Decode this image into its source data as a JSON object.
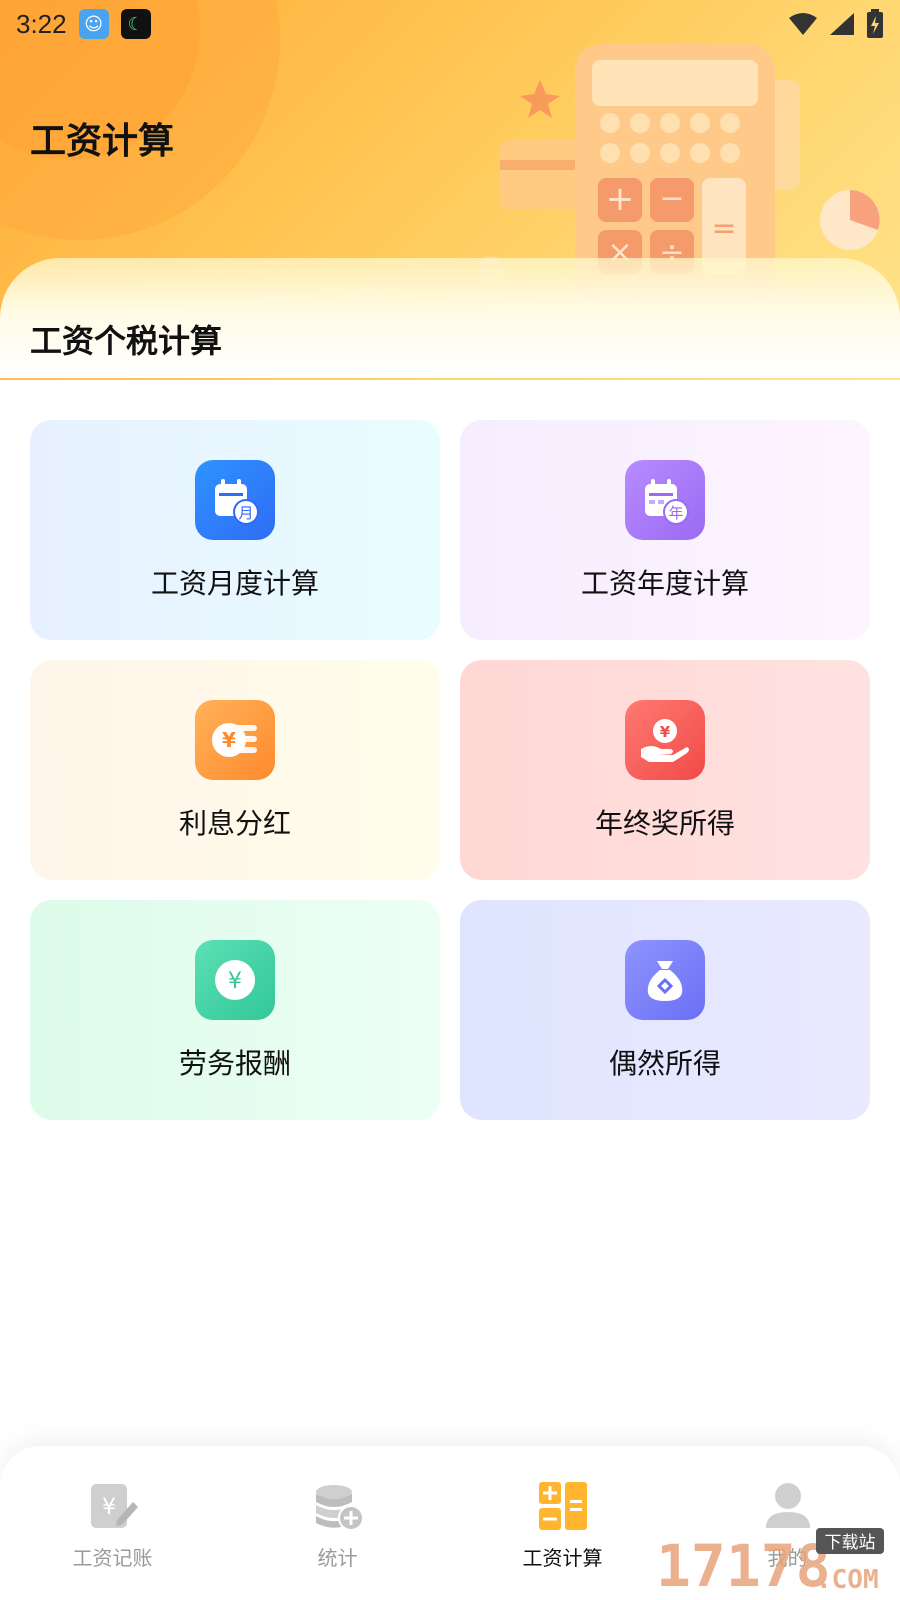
{
  "status": {
    "time": "3:22",
    "app_icons": [
      "avatar-app-icon",
      "moon-app-icon"
    ],
    "right_icons": [
      "wifi-icon",
      "signal-icon",
      "battery-charging-icon"
    ]
  },
  "header": {
    "title": "工资计算",
    "illustration": "calculator-illustration"
  },
  "section": {
    "title": "工资个税计算"
  },
  "cards": [
    {
      "label": "工资月度计算",
      "icon": "calendar-month-icon",
      "glyph": "月"
    },
    {
      "label": "工资年度计算",
      "icon": "calendar-year-icon",
      "glyph": "年"
    },
    {
      "label": "利息分红",
      "icon": "interest-coins-icon",
      "glyph": "¥"
    },
    {
      "label": "年终奖所得",
      "icon": "bonus-hand-icon",
      "glyph": "¥"
    },
    {
      "label": "劳务报酬",
      "icon": "labor-yen-icon",
      "glyph": "¥"
    },
    {
      "label": "偶然所得",
      "icon": "money-bag-icon",
      "glyph": "◇"
    }
  ],
  "tabbar": {
    "items": [
      {
        "label": "工资记账",
        "icon": "ledger-edit-icon",
        "active": false
      },
      {
        "label": "统计",
        "icon": "coins-stack-icon",
        "active": false
      },
      {
        "label": "工资计算",
        "icon": "calculator-icon",
        "active": true
      },
      {
        "label": "我的",
        "icon": "user-icon",
        "active": false
      }
    ]
  },
  "colors": {
    "header_start": "#ffa93a",
    "header_end": "#ffe48c",
    "active_tab_icon": "#ffb52e",
    "inactive_tab": "#c8c8c8"
  },
  "watermark": {
    "text": "17178",
    "sub": "下载站",
    "suffix": ".COM"
  }
}
